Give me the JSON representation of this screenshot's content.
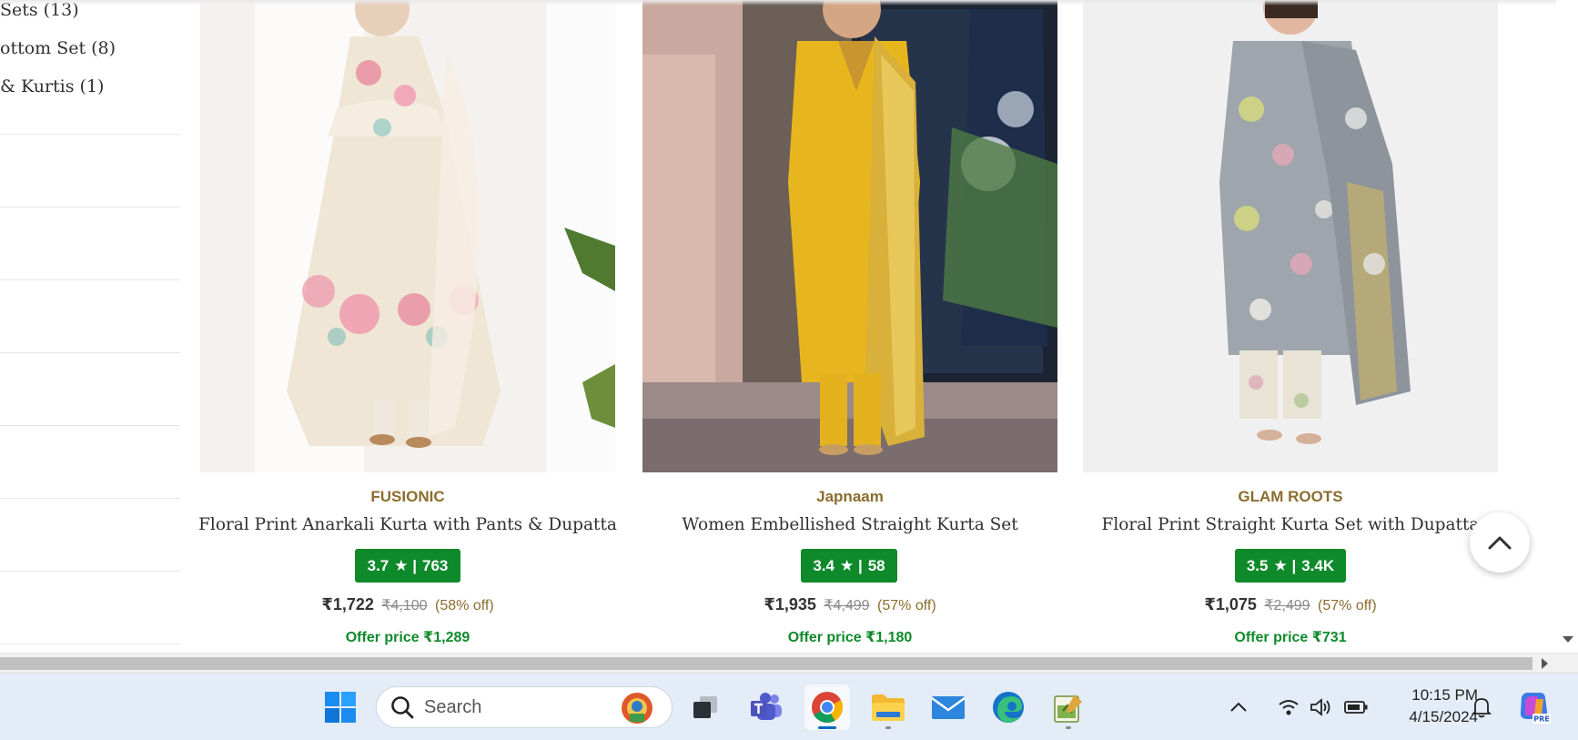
{
  "sidebar": {
    "filter_links": [
      "Sets (13)",
      "ottom Set (8)",
      "& Kurtis (1)"
    ]
  },
  "products": [
    {
      "brand": "FUSIONIC",
      "title": "Floral Print Anarkali Kurta with Pants & Dupatta",
      "rating": "3.7",
      "reviews": "763",
      "price": "₹1,722",
      "mrp": "₹4,100",
      "discount": "(58% off)",
      "offer": "Offer price ₹1,289"
    },
    {
      "brand": "Japnaam",
      "title": "Women Embellished Straight Kurta Set",
      "rating": "3.4",
      "reviews": "58",
      "price": "₹1,935",
      "mrp": "₹4,499",
      "discount": "(57% off)",
      "offer": "Offer price ₹1,180"
    },
    {
      "brand": "GLAM ROOTS",
      "title": "Floral Print Straight Kurta Set with Dupatta",
      "rating": "3.5",
      "reviews": "3.4K",
      "price": "₹1,075",
      "mrp": "₹2,499",
      "discount": "(57% off)",
      "offer": "Offer price ₹731"
    }
  ],
  "rating_separator": "★ |",
  "taskbar": {
    "search_placeholder": "Search",
    "time": "10:15 PM",
    "date": "4/15/2024",
    "apps": [
      "start-icon",
      "task-view-icon",
      "teams-icon",
      "chrome-icon",
      "file-explorer-icon",
      "mail-icon",
      "edge-icon",
      "notepad-icon"
    ]
  },
  "colors": {
    "brand_text": "#8b6d2e",
    "rating_badge": "#0f8a2b",
    "offer_text": "#0f8a2b",
    "taskbar_bg": "#e4ecf7"
  }
}
